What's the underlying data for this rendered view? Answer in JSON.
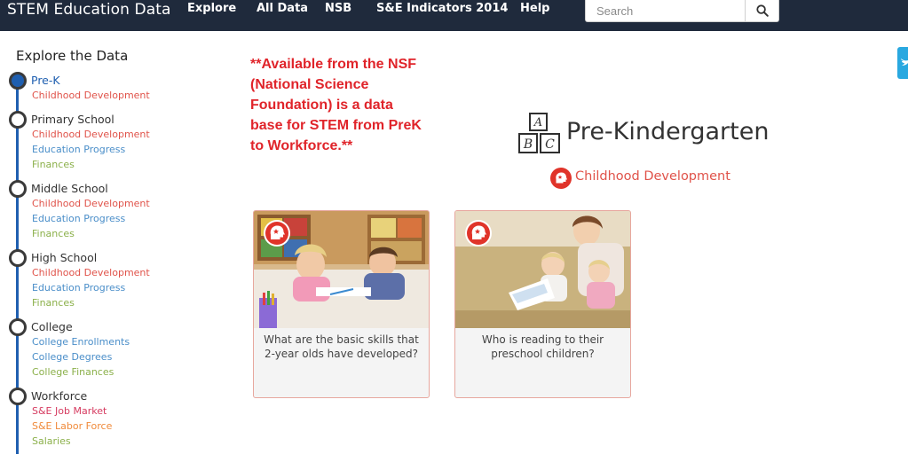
{
  "header": {
    "brand": "STEM Education Data",
    "nav": [
      "Explore",
      "All Data",
      "NSB",
      "S&E Indicators 2014",
      "Help"
    ],
    "search_placeholder": "Search"
  },
  "sidebar": {
    "title": "Explore the Data",
    "stages": [
      {
        "label": "Pre-K",
        "active": true,
        "links": [
          "Childhood Development"
        ]
      },
      {
        "label": "Primary School",
        "links": [
          "Childhood Development",
          "Education Progress",
          "Finances"
        ]
      },
      {
        "label": "Middle School",
        "links": [
          "Childhood Development",
          "Education Progress",
          "Finances"
        ]
      },
      {
        "label": "High School",
        "links": [
          "Childhood Development",
          "Education Progress",
          "Finances"
        ]
      },
      {
        "label": "College",
        "links": [
          "College Enrollments",
          "College Degrees",
          "College Finances"
        ]
      },
      {
        "label": "Workforce",
        "links": [
          "S&E Job Market",
          "S&E Labor Force",
          "Salaries"
        ]
      }
    ]
  },
  "note": "**Available from the NSF (National Science Foundation) is a data base for STEM from PreK to Workforce.**",
  "main": {
    "title": "Pre-Kindergarten",
    "icon_letters": [
      "A",
      "B",
      "C"
    ],
    "category": "Childhood Development",
    "cards": [
      {
        "caption": "What are the basic skills that 2-year olds have developed?"
      },
      {
        "caption": "Who is reading to their preschool children?"
      }
    ]
  },
  "colors": {
    "nav_bg": "#1f2a3c",
    "timeline": "#1f5fb0",
    "childhood_development": "#e0534a",
    "education_progress": "#4a8ec9",
    "finances": "#8bb04a",
    "note": "#e0242a",
    "twitter": "#29a8e0"
  },
  "icons": [
    "search-icon",
    "twitter-icon",
    "abc-blocks-icon",
    "head-icon"
  ]
}
